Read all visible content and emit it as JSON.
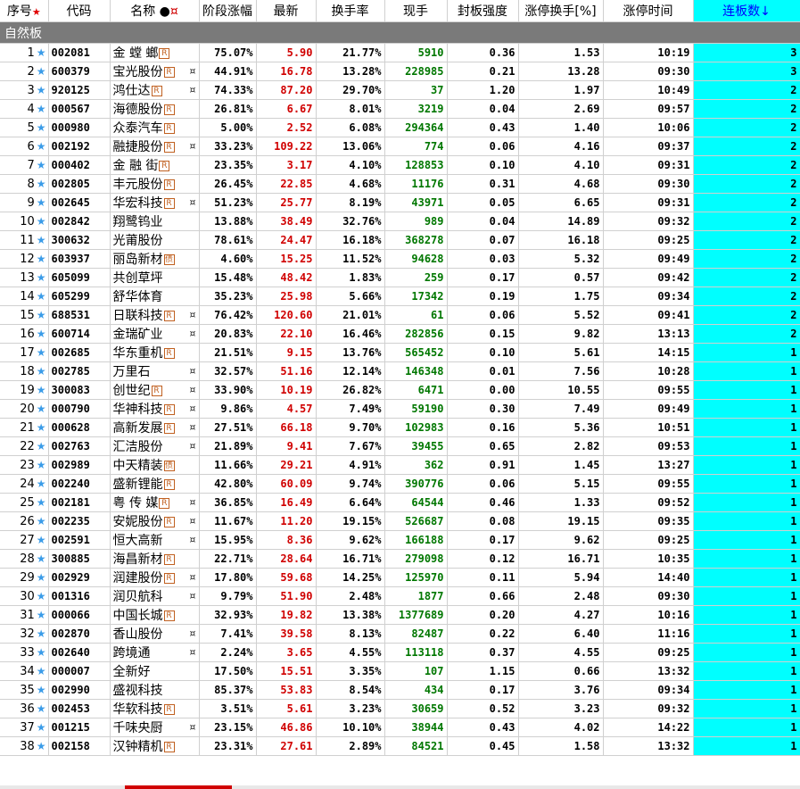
{
  "headers": {
    "idx": "序号",
    "code": "代码",
    "name": "名称",
    "change": "阶段涨幅",
    "price": "最新",
    "turnover": "换手率",
    "vol": "现手",
    "seal": "封板强度",
    "limit_turnover": "涨停换手[%]",
    "limit_time": "涨停时间",
    "streak": "连板数↓"
  },
  "section_title": "自然板",
  "rows": [
    {
      "idx": "1",
      "code": "002081",
      "name": "金 螳 螂",
      "badge": "R",
      "hot": "",
      "change": "75.07%",
      "price": "5.90",
      "turnover": "21.77%",
      "vol": "5910",
      "seal": "0.36",
      "limit_turnover": "1.53",
      "limit_time": "10:19",
      "streak": "3"
    },
    {
      "idx": "2",
      "code": "600379",
      "name": "宝光股份",
      "badge": "R",
      "hot": "¤",
      "change": "44.91%",
      "price": "16.78",
      "turnover": "13.28%",
      "vol": "228985",
      "seal": "0.21",
      "limit_turnover": "13.28",
      "limit_time": "09:30",
      "streak": "3"
    },
    {
      "idx": "3",
      "code": "920125",
      "name": "鸿仕达",
      "badge": "R",
      "hot": "¤",
      "change": "74.33%",
      "price": "87.20",
      "turnover": "29.70%",
      "vol": "37",
      "seal": "1.20",
      "limit_turnover": "1.97",
      "limit_time": "10:49",
      "streak": "2"
    },
    {
      "idx": "4",
      "code": "000567",
      "name": "海德股份",
      "badge": "R",
      "hot": "",
      "change": "26.81%",
      "price": "6.67",
      "turnover": "8.01%",
      "vol": "3219",
      "seal": "0.04",
      "limit_turnover": "2.69",
      "limit_time": "09:57",
      "streak": "2"
    },
    {
      "idx": "5",
      "code": "000980",
      "name": "众泰汽车",
      "badge": "R",
      "hot": "",
      "change": "5.00%",
      "price": "2.52",
      "turnover": "6.08%",
      "vol": "294364",
      "seal": "0.43",
      "limit_turnover": "1.40",
      "limit_time": "10:06",
      "streak": "2"
    },
    {
      "idx": "6",
      "code": "002192",
      "name": "融捷股份",
      "badge": "R",
      "hot": "¤",
      "change": "33.23%",
      "price": "109.22",
      "turnover": "13.06%",
      "vol": "774",
      "seal": "0.06",
      "limit_turnover": "4.16",
      "limit_time": "09:37",
      "streak": "2"
    },
    {
      "idx": "7",
      "code": "000402",
      "name": "金 融 街",
      "badge": "R",
      "hot": "",
      "change": "23.35%",
      "price": "3.17",
      "turnover": "4.10%",
      "vol": "128853",
      "seal": "0.10",
      "limit_turnover": "4.10",
      "limit_time": "09:31",
      "streak": "2"
    },
    {
      "idx": "8",
      "code": "002805",
      "name": "丰元股份",
      "badge": "R",
      "hot": "",
      "change": "26.45%",
      "price": "22.85",
      "turnover": "4.68%",
      "vol": "11176",
      "seal": "0.31",
      "limit_turnover": "4.68",
      "limit_time": "09:30",
      "streak": "2"
    },
    {
      "idx": "9",
      "code": "002645",
      "name": "华宏科技",
      "badge": "R",
      "hot": "¤",
      "change": "51.23%",
      "price": "25.77",
      "turnover": "8.19%",
      "vol": "43971",
      "seal": "0.05",
      "limit_turnover": "6.65",
      "limit_time": "09:31",
      "streak": "2"
    },
    {
      "idx": "10",
      "code": "002842",
      "name": "翔鹭钨业",
      "badge": "",
      "hot": "",
      "change": "13.88%",
      "price": "38.49",
      "turnover": "32.76%",
      "vol": "989",
      "seal": "0.04",
      "limit_turnover": "14.89",
      "limit_time": "09:32",
      "streak": "2"
    },
    {
      "idx": "11",
      "code": "300632",
      "name": "光莆股份",
      "badge": "",
      "hot": "",
      "change": "78.61%",
      "price": "24.47",
      "turnover": "16.18%",
      "vol": "368278",
      "seal": "0.07",
      "limit_turnover": "16.18",
      "limit_time": "09:25",
      "streak": "2"
    },
    {
      "idx": "12",
      "code": "603937",
      "name": "丽岛新材",
      "badge": "债",
      "hot": "",
      "change": "4.60%",
      "price": "15.25",
      "turnover": "11.52%",
      "vol": "94628",
      "seal": "0.03",
      "limit_turnover": "5.32",
      "limit_time": "09:49",
      "streak": "2"
    },
    {
      "idx": "13",
      "code": "605099",
      "name": "共创草坪",
      "badge": "",
      "hot": "",
      "change": "15.48%",
      "price": "48.42",
      "turnover": "1.83%",
      "vol": "259",
      "seal": "0.17",
      "limit_turnover": "0.57",
      "limit_time": "09:42",
      "streak": "2"
    },
    {
      "idx": "14",
      "code": "605299",
      "name": "舒华体育",
      "badge": "",
      "hot": "",
      "change": "35.23%",
      "price": "25.98",
      "turnover": "5.66%",
      "vol": "17342",
      "seal": "0.19",
      "limit_turnover": "1.75",
      "limit_time": "09:34",
      "streak": "2"
    },
    {
      "idx": "15",
      "code": "688531",
      "name": "日联科技",
      "badge": "R",
      "hot": "¤",
      "change": "76.42%",
      "price": "120.60",
      "turnover": "21.01%",
      "vol": "61",
      "seal": "0.06",
      "limit_turnover": "5.52",
      "limit_time": "09:41",
      "streak": "2"
    },
    {
      "idx": "16",
      "code": "600714",
      "name": "金瑞矿业",
      "badge": "",
      "hot": "¤",
      "change": "20.83%",
      "price": "22.10",
      "turnover": "16.46%",
      "vol": "282856",
      "seal": "0.15",
      "limit_turnover": "9.82",
      "limit_time": "13:13",
      "streak": "2"
    },
    {
      "idx": "17",
      "code": "002685",
      "name": "华东重机",
      "badge": "R",
      "hot": "",
      "change": "21.51%",
      "price": "9.15",
      "turnover": "13.76%",
      "vol": "565452",
      "seal": "0.10",
      "limit_turnover": "5.61",
      "limit_time": "14:15",
      "streak": "1"
    },
    {
      "idx": "18",
      "code": "002785",
      "name": "万里石",
      "badge": "",
      "hot": "¤",
      "change": "32.57%",
      "price": "51.16",
      "turnover": "12.14%",
      "vol": "146348",
      "seal": "0.01",
      "limit_turnover": "7.56",
      "limit_time": "10:28",
      "streak": "1"
    },
    {
      "idx": "19",
      "code": "300083",
      "name": "创世纪",
      "badge": "R",
      "hot": "¤",
      "change": "33.90%",
      "price": "10.19",
      "turnover": "26.82%",
      "vol": "6471",
      "seal": "0.00",
      "limit_turnover": "10.55",
      "limit_time": "09:55",
      "streak": "1"
    },
    {
      "idx": "20",
      "code": "000790",
      "name": "华神科技",
      "badge": "R",
      "hot": "¤",
      "change": "9.86%",
      "price": "4.57",
      "turnover": "7.49%",
      "vol": "59190",
      "seal": "0.30",
      "limit_turnover": "7.49",
      "limit_time": "09:49",
      "streak": "1"
    },
    {
      "idx": "21",
      "code": "000628",
      "name": "高新发展",
      "badge": "R",
      "hot": "¤",
      "change": "27.51%",
      "price": "66.18",
      "turnover": "9.70%",
      "vol": "102983",
      "seal": "0.16",
      "limit_turnover": "5.36",
      "limit_time": "10:51",
      "streak": "1"
    },
    {
      "idx": "22",
      "code": "002763",
      "name": "汇洁股份",
      "badge": "",
      "hot": "¤",
      "change": "21.89%",
      "price": "9.41",
      "turnover": "7.67%",
      "vol": "39455",
      "seal": "0.65",
      "limit_turnover": "2.82",
      "limit_time": "09:53",
      "streak": "1"
    },
    {
      "idx": "23",
      "code": "002989",
      "name": "中天精装",
      "badge": "债",
      "hot": "",
      "change": "11.66%",
      "price": "29.21",
      "turnover": "4.91%",
      "vol": "362",
      "seal": "0.91",
      "limit_turnover": "1.45",
      "limit_time": "13:27",
      "streak": "1"
    },
    {
      "idx": "24",
      "code": "002240",
      "name": "盛新锂能",
      "badge": "R",
      "hot": "",
      "change": "42.80%",
      "price": "60.09",
      "turnover": "9.74%",
      "vol": "390776",
      "seal": "0.06",
      "limit_turnover": "5.15",
      "limit_time": "09:55",
      "streak": "1"
    },
    {
      "idx": "25",
      "code": "002181",
      "name": "粤 传 媒",
      "badge": "R",
      "hot": "¤",
      "change": "36.85%",
      "price": "16.49",
      "turnover": "6.64%",
      "vol": "64544",
      "seal": "0.46",
      "limit_turnover": "1.33",
      "limit_time": "09:52",
      "streak": "1"
    },
    {
      "idx": "26",
      "code": "002235",
      "name": "安妮股份",
      "badge": "R",
      "hot": "¤",
      "change": "11.67%",
      "price": "11.20",
      "turnover": "19.15%",
      "vol": "526687",
      "seal": "0.08",
      "limit_turnover": "19.15",
      "limit_time": "09:35",
      "streak": "1"
    },
    {
      "idx": "27",
      "code": "002591",
      "name": "恒大高新",
      "badge": "",
      "hot": "¤",
      "change": "15.95%",
      "price": "8.36",
      "turnover": "9.62%",
      "vol": "166188",
      "seal": "0.17",
      "limit_turnover": "9.62",
      "limit_time": "09:25",
      "streak": "1"
    },
    {
      "idx": "28",
      "code": "300885",
      "name": "海昌新材",
      "badge": "R",
      "hot": "",
      "change": "22.71%",
      "price": "28.64",
      "turnover": "16.71%",
      "vol": "279098",
      "seal": "0.12",
      "limit_turnover": "16.71",
      "limit_time": "10:35",
      "streak": "1"
    },
    {
      "idx": "29",
      "code": "002929",
      "name": "润建股份",
      "badge": "R",
      "hot": "¤",
      "change": "17.80%",
      "price": "59.68",
      "turnover": "14.25%",
      "vol": "125970",
      "seal": "0.11",
      "limit_turnover": "5.94",
      "limit_time": "14:40",
      "streak": "1"
    },
    {
      "idx": "30",
      "code": "001316",
      "name": "润贝航科",
      "badge": "",
      "hot": "¤",
      "change": "9.79%",
      "price": "51.90",
      "turnover": "2.48%",
      "vol": "1877",
      "seal": "0.66",
      "limit_turnover": "2.48",
      "limit_time": "09:30",
      "streak": "1"
    },
    {
      "idx": "31",
      "code": "000066",
      "name": "中国长城",
      "badge": "R",
      "hot": "",
      "change": "32.93%",
      "price": "19.82",
      "turnover": "13.38%",
      "vol": "1377689",
      "seal": "0.20",
      "limit_turnover": "4.27",
      "limit_time": "10:16",
      "streak": "1"
    },
    {
      "idx": "32",
      "code": "002870",
      "name": "香山股份",
      "badge": "",
      "hot": "¤",
      "change": "7.41%",
      "price": "39.58",
      "turnover": "8.13%",
      "vol": "82487",
      "seal": "0.22",
      "limit_turnover": "6.40",
      "limit_time": "11:16",
      "streak": "1"
    },
    {
      "idx": "33",
      "code": "002640",
      "name": "跨境通",
      "badge": "",
      "hot": "¤",
      "change": "2.24%",
      "price": "3.65",
      "turnover": "4.55%",
      "vol": "113118",
      "seal": "0.37",
      "limit_turnover": "4.55",
      "limit_time": "09:25",
      "streak": "1"
    },
    {
      "idx": "34",
      "code": "000007",
      "name": "全新好",
      "badge": "",
      "hot": "",
      "change": "17.50%",
      "price": "15.51",
      "turnover": "3.35%",
      "vol": "107",
      "seal": "1.15",
      "limit_turnover": "0.66",
      "limit_time": "13:32",
      "streak": "1"
    },
    {
      "idx": "35",
      "code": "002990",
      "name": "盛视科技",
      "badge": "",
      "hot": "",
      "change": "85.37%",
      "price": "53.83",
      "turnover": "8.54%",
      "vol": "434",
      "seal": "0.17",
      "limit_turnover": "3.76",
      "limit_time": "09:34",
      "streak": "1"
    },
    {
      "idx": "36",
      "code": "002453",
      "name": "华软科技",
      "badge": "R",
      "hot": "",
      "change": "3.51%",
      "price": "5.61",
      "turnover": "3.23%",
      "vol": "30659",
      "seal": "0.52",
      "limit_turnover": "3.23",
      "limit_time": "09:32",
      "streak": "1"
    },
    {
      "idx": "37",
      "code": "001215",
      "name": "千味央厨",
      "badge": "",
      "hot": "¤",
      "change": "23.15%",
      "price": "46.86",
      "turnover": "10.10%",
      "vol": "38944",
      "seal": "0.43",
      "limit_turnover": "4.02",
      "limit_time": "14:22",
      "streak": "1"
    },
    {
      "idx": "38",
      "code": "002158",
      "name": "汉钟精机",
      "badge": "R",
      "hot": "",
      "change": "23.31%",
      "price": "27.61",
      "turnover": "2.89%",
      "vol": "84521",
      "seal": "0.45",
      "limit_turnover": "1.58",
      "limit_time": "13:32",
      "streak": "1"
    }
  ]
}
